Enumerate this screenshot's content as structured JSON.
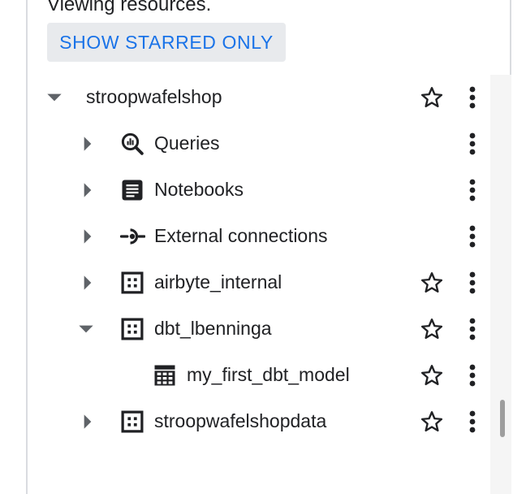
{
  "header": {
    "viewing_text": "Viewing resources.",
    "show_starred_label": "SHOW STARRED ONLY"
  },
  "tree": {
    "project": {
      "label": "stroopwafelshop",
      "expanded": true,
      "starred": false
    },
    "items": [
      {
        "label": "Queries",
        "icon": "queries-icon",
        "expanded": false
      },
      {
        "label": "Notebooks",
        "icon": "notebook-icon",
        "expanded": false
      },
      {
        "label": "External connections",
        "icon": "connection-icon",
        "expanded": false
      },
      {
        "label": "airbyte_internal",
        "icon": "dataset-icon",
        "expanded": false,
        "starred": false
      },
      {
        "label": "dbt_lbenninga",
        "icon": "dataset-icon",
        "expanded": true,
        "starred": false
      },
      {
        "label": "my_first_dbt_model",
        "icon": "table-icon",
        "starred": false
      },
      {
        "label": "stroopwafelshopdata",
        "icon": "dataset-icon",
        "expanded": false,
        "starred": false
      }
    ]
  },
  "colors": {
    "accent": "#1a73e8",
    "button_bg": "#e8eaed",
    "text": "#202124",
    "toggle": "#5f6368"
  }
}
